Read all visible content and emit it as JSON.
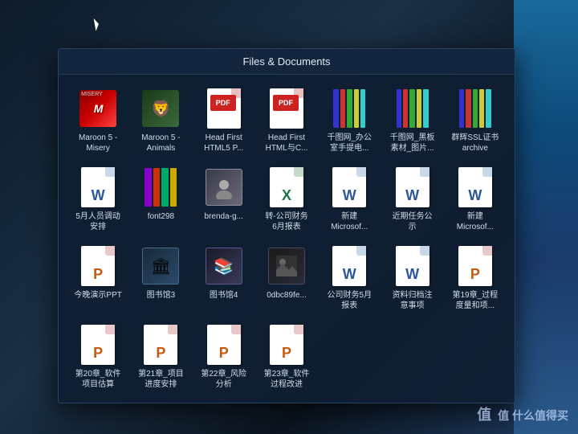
{
  "window": {
    "title": "Files & Documents"
  },
  "files": [
    {
      "id": "maroon-misery",
      "label": "Maroon 5 -\nMisery",
      "type": "album-misery"
    },
    {
      "id": "maroon-animals",
      "label": "Maroon 5 -\nAnimals",
      "type": "album-animals"
    },
    {
      "id": "head-first-html5",
      "label": "Head First\nHTML5 P...",
      "type": "pdf"
    },
    {
      "id": "head-first-htmlc",
      "label": "Head First\nHTML与C...",
      "type": "pdf"
    },
    {
      "id": "qiantu-office",
      "label": "千图网_办公\n室手提电...",
      "type": "rar"
    },
    {
      "id": "qiantu-black",
      "label": "千图网_黑板\n素材_图片...",
      "type": "rar"
    },
    {
      "id": "ssl-archive",
      "label": "群辉SSL证书\narchive",
      "type": "rar"
    },
    {
      "id": "may-staff",
      "label": "5月人员调动\n安排",
      "type": "word"
    },
    {
      "id": "font298",
      "label": "font298",
      "type": "font-rar"
    },
    {
      "id": "brenda-g",
      "label": "brenda-g...",
      "type": "photo1"
    },
    {
      "id": "financial-report",
      "label": "转-公司财务\n6月报表",
      "type": "excel"
    },
    {
      "id": "new-microsoft1",
      "label": "新建\nMicrosof...",
      "type": "word"
    },
    {
      "id": "recent-tasks",
      "label": "近期任务公\n示",
      "type": "word"
    },
    {
      "id": "new-microsoft2",
      "label": "新建\nMicrosof...",
      "type": "word"
    },
    {
      "id": "ppt-tonight",
      "label": "今晚演示PPT",
      "type": "ppt"
    },
    {
      "id": "library3",
      "label": "图书馆3",
      "type": "photo2"
    },
    {
      "id": "library4",
      "label": "图书馆4",
      "type": "photo3"
    },
    {
      "id": "0dbc89fe",
      "label": "0dbc89fe...",
      "type": "photo-dark"
    },
    {
      "id": "financial-may",
      "label": "公司财务5月\n报表",
      "type": "word"
    },
    {
      "id": "archive-notes",
      "label": "资料归档注\n意事项",
      "type": "word"
    },
    {
      "id": "chapter19",
      "label": "第19章_过程\n度量和项...",
      "type": "ppt"
    },
    {
      "id": "chapter20",
      "label": "第20章_软件\n项目估算",
      "type": "ppt"
    },
    {
      "id": "chapter21",
      "label": "第21章_项目\n进度安排",
      "type": "ppt"
    },
    {
      "id": "chapter22",
      "label": "第22章_风险\n分析",
      "type": "ppt"
    },
    {
      "id": "chapter23",
      "label": "第23章_软件\n过程改进",
      "type": "ppt"
    }
  ],
  "watermark": "值 什么值得买"
}
